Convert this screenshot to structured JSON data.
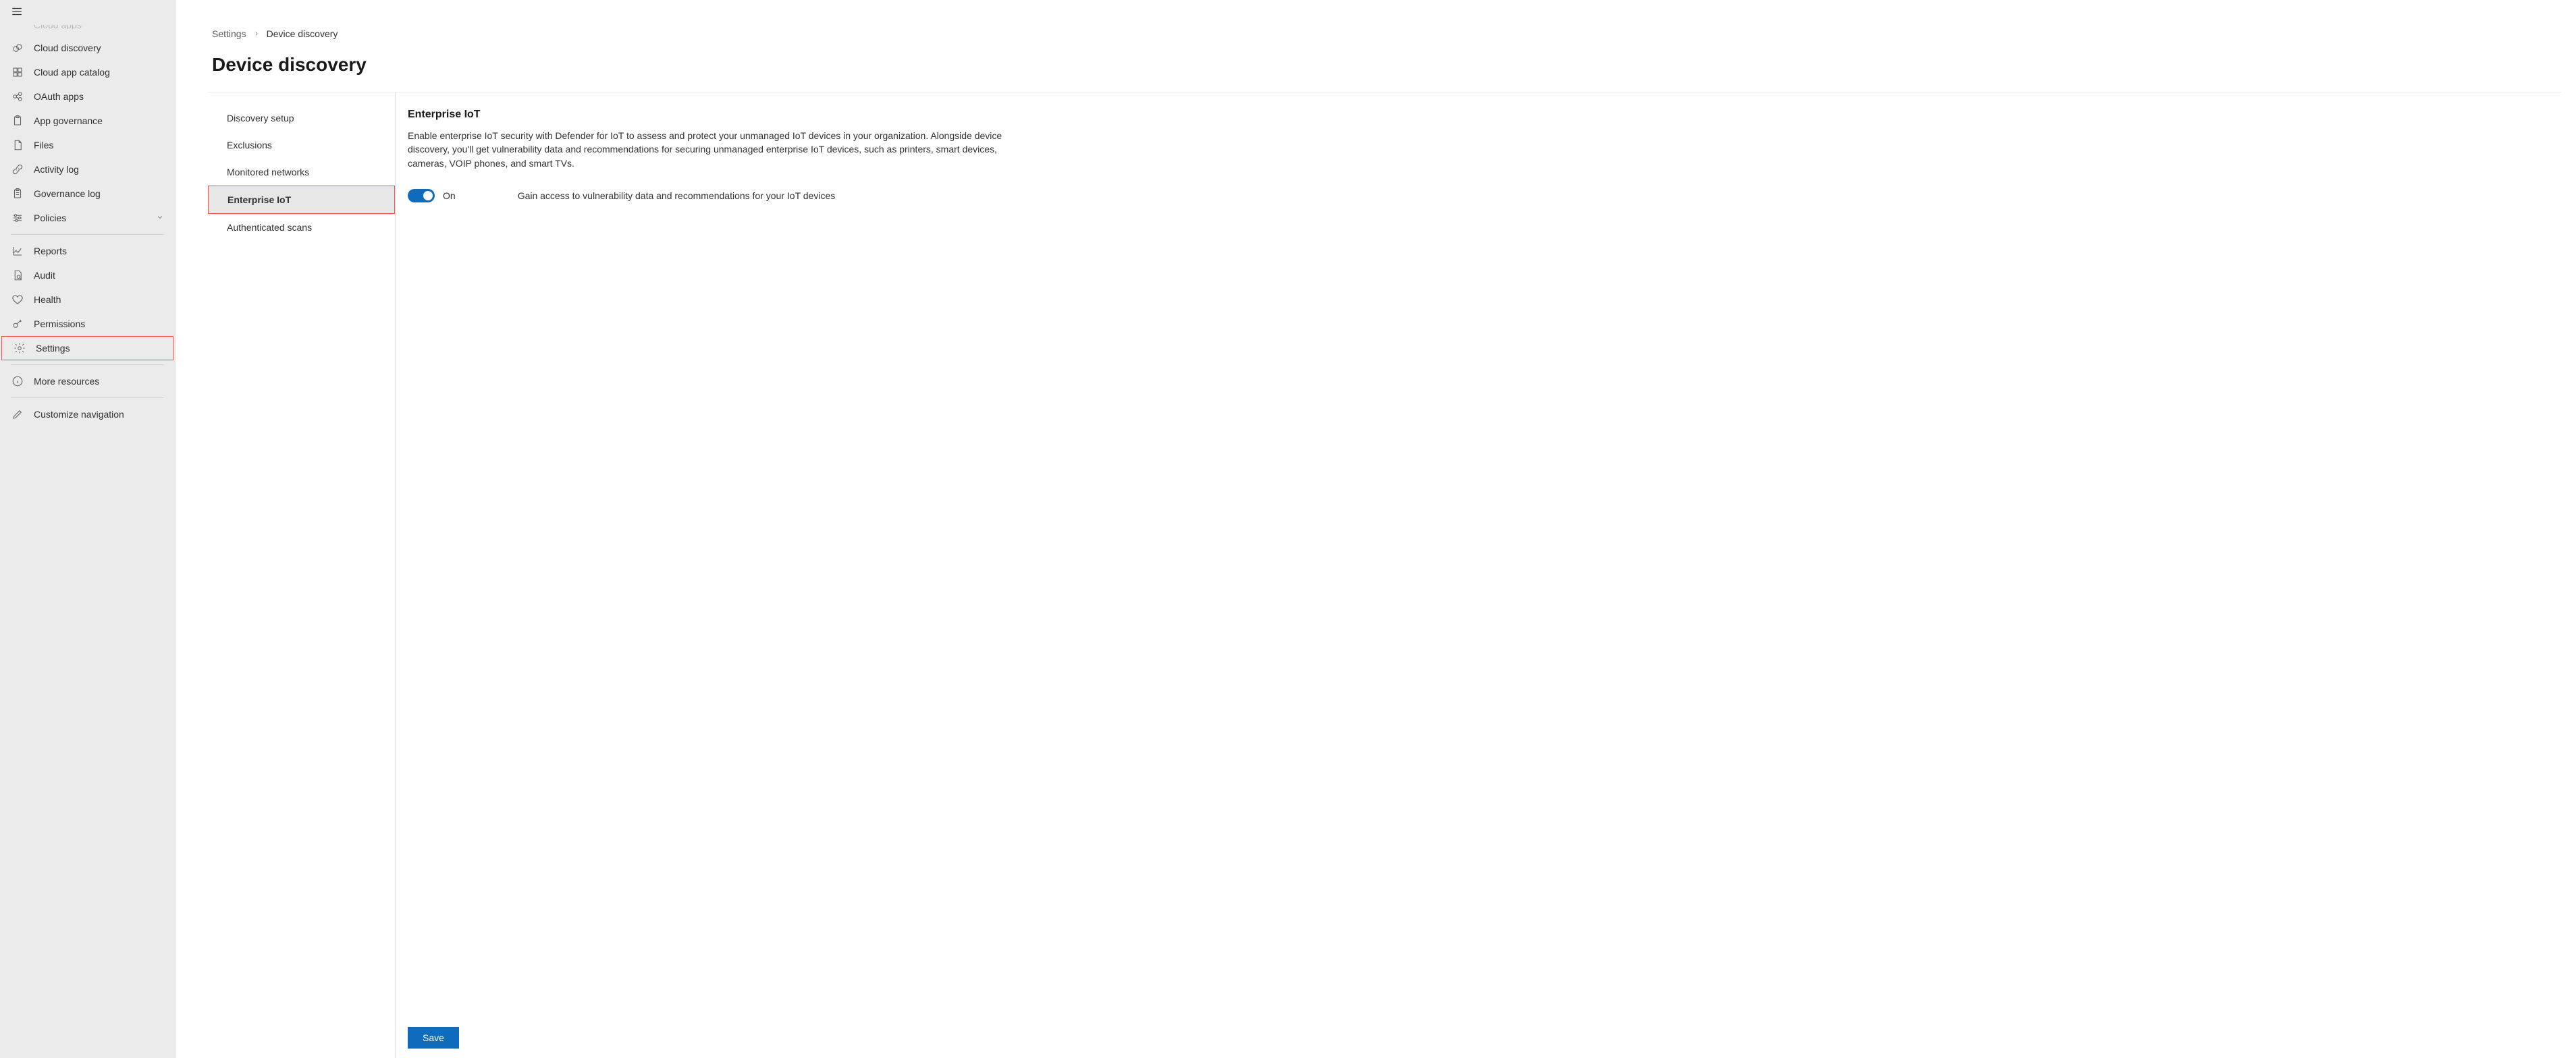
{
  "sidebar": {
    "partial_top_label": "Cloud apps",
    "items": [
      {
        "label": "Cloud discovery",
        "icon": "cloud-discovery-icon"
      },
      {
        "label": "Cloud app catalog",
        "icon": "catalog-icon"
      },
      {
        "label": "OAuth apps",
        "icon": "oauth-icon"
      },
      {
        "label": "App governance",
        "icon": "clipboard-icon"
      },
      {
        "label": "Files",
        "icon": "file-icon"
      },
      {
        "label": "Activity log",
        "icon": "link-icon"
      },
      {
        "label": "Governance log",
        "icon": "clipboard-icon"
      },
      {
        "label": "Policies",
        "icon": "sliders-icon",
        "expandable": true
      }
    ],
    "lower_items": [
      {
        "label": "Reports",
        "icon": "chart-icon"
      },
      {
        "label": "Audit",
        "icon": "audit-icon"
      },
      {
        "label": "Health",
        "icon": "heart-icon"
      },
      {
        "label": "Permissions",
        "icon": "key-icon"
      },
      {
        "label": "Settings",
        "icon": "gear-icon",
        "highlighted": true
      }
    ],
    "footer_items": [
      {
        "label": "More resources",
        "icon": "info-icon"
      },
      {
        "label": "Customize navigation",
        "icon": "pencil-icon"
      }
    ]
  },
  "breadcrumb": {
    "root": "Settings",
    "current": "Device discovery"
  },
  "page_title": "Device discovery",
  "secnav": {
    "items": [
      "Discovery setup",
      "Exclusions",
      "Monitored networks",
      "Enterprise IoT",
      "Authenticated scans"
    ],
    "active_index": 3
  },
  "detail": {
    "heading": "Enterprise IoT",
    "description": "Enable enterprise IoT security with Defender for IoT to assess and protect your unmanaged IoT devices in your organization. Alongside device discovery, you'll get vulnerability data and recommendations for securing unmanaged enterprise IoT devices, such as printers, smart devices, cameras, VOIP phones, and smart TVs.",
    "toggle_state_label": "On",
    "toggle_description": "Gain access to vulnerability data and recommendations for your IoT devices",
    "save_label": "Save"
  }
}
